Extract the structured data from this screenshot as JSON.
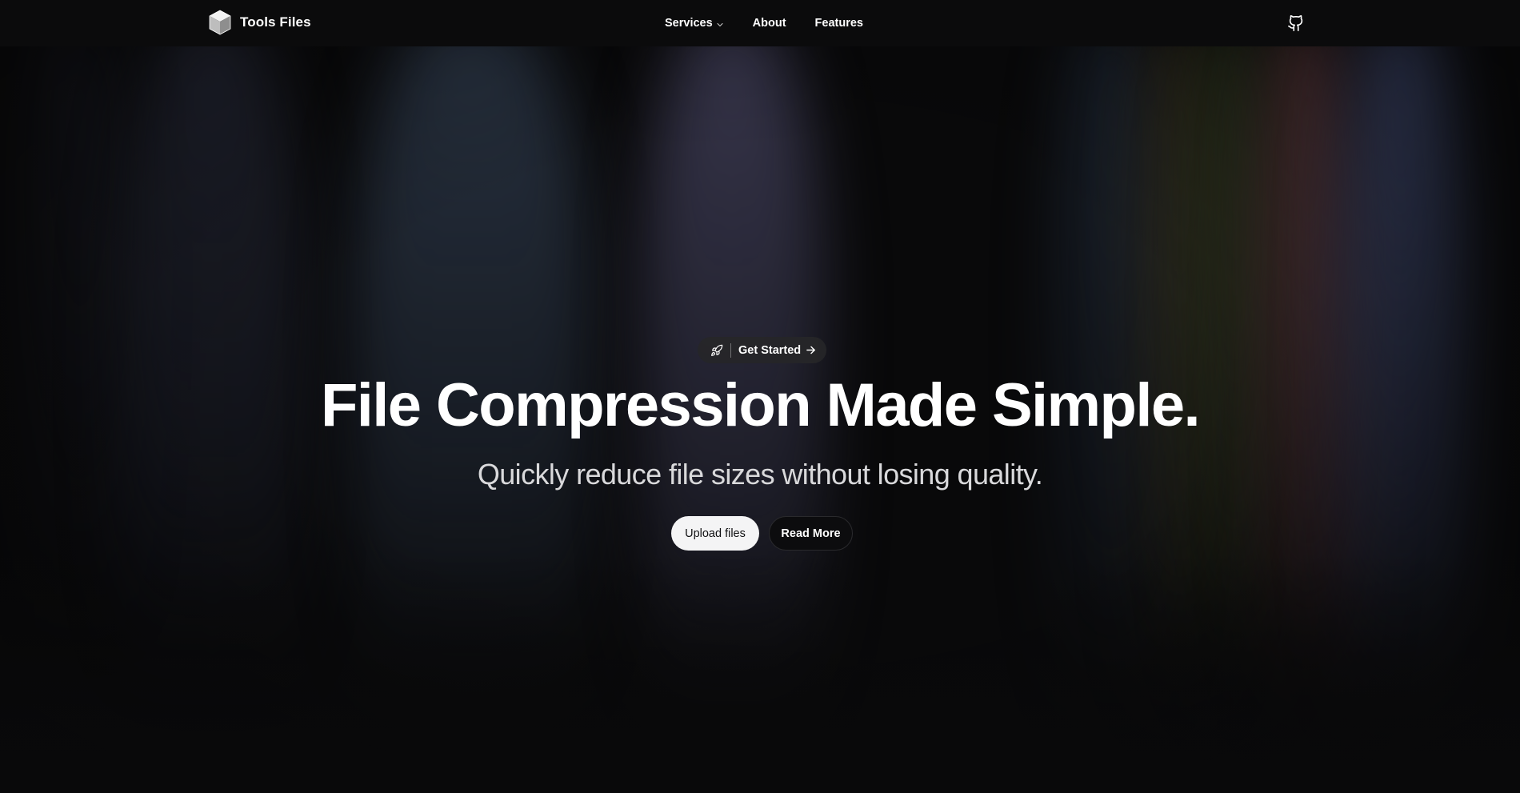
{
  "header": {
    "brand": {
      "name": "Tools Files",
      "icon": "cube-icon"
    },
    "nav": [
      {
        "label": "Services",
        "icon": "chevron-down-icon"
      },
      {
        "label": "About"
      },
      {
        "label": "Features"
      }
    ],
    "github_icon": "github-icon"
  },
  "hero": {
    "badge": {
      "icon": "rocket-icon",
      "label": "Get Started",
      "trailing_icon": "arrow-right-icon"
    },
    "title": "File Compression Made Simple.",
    "subtitle": "Quickly reduce file sizes without losing quality.",
    "buttons": {
      "primary": "Upload files",
      "secondary": "Read More"
    }
  },
  "colors": {
    "background": "#09090a",
    "header_bg": "#0b0b0c",
    "text": "#ffffff",
    "primary_button_bg": "#f4f4f5",
    "primary_button_text": "#111113"
  }
}
